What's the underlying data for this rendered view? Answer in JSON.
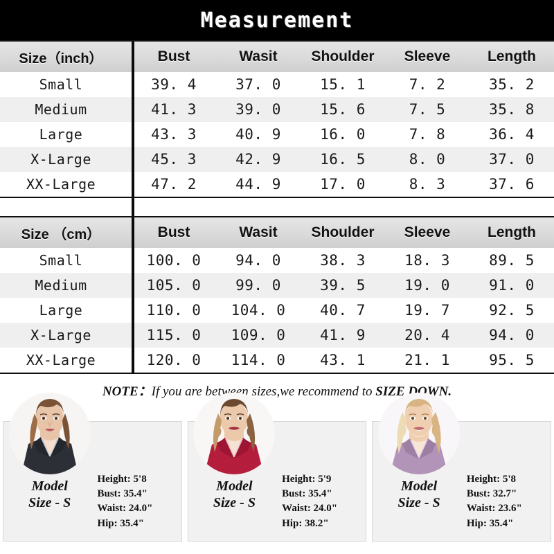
{
  "title": "Measurement",
  "tables": [
    {
      "id": "inch",
      "size_header": "Size（inch）",
      "columns": [
        "Bust",
        "Wasit",
        "Shoulder",
        "Sleeve",
        "Length"
      ],
      "rows": [
        {
          "size": "Small",
          "values": [
            "39. 4",
            "37. 0",
            "15. 1",
            "7. 2",
            "35. 2"
          ]
        },
        {
          "size": "Medium",
          "values": [
            "41. 3",
            "39. 0",
            "15. 6",
            "7. 5",
            "35. 8"
          ]
        },
        {
          "size": "Large",
          "values": [
            "43. 3",
            "40. 9",
            "16. 0",
            "7. 8",
            "36. 4"
          ]
        },
        {
          "size": "X-Large",
          "values": [
            "45. 3",
            "42. 9",
            "16. 5",
            "8. 0",
            "37. 0"
          ]
        },
        {
          "size": "XX-Large",
          "values": [
            "47. 2",
            "44. 9",
            "17. 0",
            "8. 3",
            "37. 6"
          ]
        }
      ]
    },
    {
      "id": "cm",
      "size_header": "Size （cm）",
      "columns": [
        "Bust",
        "Wasit",
        "Shoulder",
        "Sleeve",
        "Length"
      ],
      "rows": [
        {
          "size": "Small",
          "values": [
            "100. 0",
            "94. 0",
            "38. 3",
            "18. 3",
            "89. 5"
          ]
        },
        {
          "size": "Medium",
          "values": [
            "105. 0",
            "99. 0",
            "39. 5",
            "19. 0",
            "91. 0"
          ]
        },
        {
          "size": "Large",
          "values": [
            "110. 0",
            "104. 0",
            "40. 7",
            "19. 7",
            "92. 5"
          ]
        },
        {
          "size": "X-Large",
          "values": [
            "115. 0",
            "109. 0",
            "41. 9",
            "20. 4",
            "94. 0"
          ]
        },
        {
          "size": "XX-Large",
          "values": [
            "120. 0",
            "114. 0",
            "43. 1",
            "21. 1",
            "95. 5"
          ]
        }
      ]
    }
  ],
  "note": {
    "lead": "NOTE：",
    "body": "If you are between sizes,we recommend to ",
    "emphasis": "SIZE DOWN."
  },
  "models": [
    {
      "label_line1": "Model",
      "label_line2": "Size - S",
      "height": "Height: 5'8",
      "bust": "Bust: 35.4\"",
      "waist": "Waist: 24.0\"",
      "hip": "Hip: 35.4\"",
      "hair": "#7a5236",
      "hair_light": "#9c6d46",
      "skin": "#e8c4a8",
      "garment": "#2c2f36",
      "garment_trim": "#c9cdd4"
    },
    {
      "label_line1": "Model",
      "label_line2": "Size - S",
      "height": "Height: 5'9",
      "bust": "Bust: 35.4\"",
      "waist": "Waist: 24.0\"",
      "hip": "Hip: 38.2\"",
      "hair": "#6b4a30",
      "hair_light": "#c39b6a",
      "skin": "#ecc9ab",
      "garment": "#b51d3c",
      "garment_trim": "#e8c0c9"
    },
    {
      "label_line1": "Model",
      "label_line2": "Size - S",
      "height": "Height: 5'8",
      "bust": "Bust: 32.7\"",
      "waist": "Waist: 23.6\"",
      "hip": "Hip: 35.4\"",
      "hair": "#d8b483",
      "hair_light": "#eddbb6",
      "skin": "#f0cfb1",
      "garment": "#b294b8",
      "garment_trim": "#e4d3e6"
    }
  ],
  "colors": {
    "title_bar": "#000000",
    "title_text": "#ffffff",
    "header_band": "#dadada",
    "row_odd": "#ffffff",
    "row_even": "#efefef",
    "divider": "#0a0a0a",
    "card_bg": "#f1f1f1"
  }
}
